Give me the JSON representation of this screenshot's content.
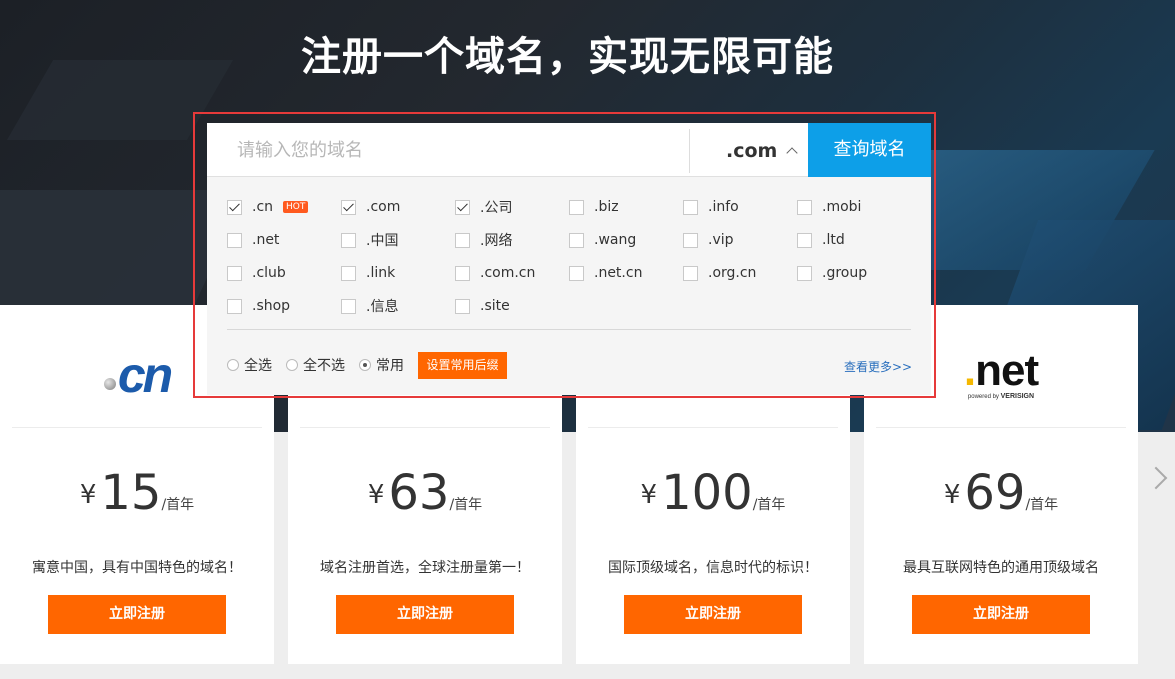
{
  "headline": "注册一个域名，实现无限可能",
  "search": {
    "placeholder": "请输入您的域名",
    "tld": ".com",
    "button": "查询域名"
  },
  "suffixes": [
    {
      "label": ".cn",
      "checked": true,
      "hot": "HOT"
    },
    {
      "label": ".com",
      "checked": true
    },
    {
      "label": ".公司",
      "checked": true
    },
    {
      "label": ".biz",
      "checked": false
    },
    {
      "label": ".info",
      "checked": false
    },
    {
      "label": ".mobi",
      "checked": false
    },
    {
      "label": ".net",
      "checked": false
    },
    {
      "label": ".中国",
      "checked": false
    },
    {
      "label": ".网络",
      "checked": false
    },
    {
      "label": ".wang",
      "checked": false
    },
    {
      "label": ".vip",
      "checked": false
    },
    {
      "label": ".ltd",
      "checked": false
    },
    {
      "label": ".club",
      "checked": false
    },
    {
      "label": ".link",
      "checked": false
    },
    {
      "label": ".com.cn",
      "checked": false
    },
    {
      "label": ".net.cn",
      "checked": false
    },
    {
      "label": ".org.cn",
      "checked": false
    },
    {
      "label": ".group",
      "checked": false
    },
    {
      "label": ".shop",
      "checked": false
    },
    {
      "label": ".信息",
      "checked": false
    },
    {
      "label": ".site",
      "checked": false
    }
  ],
  "selection": {
    "options": [
      {
        "label": "全选",
        "selected": false
      },
      {
        "label": "全不选",
        "selected": false
      },
      {
        "label": "常用",
        "selected": true
      }
    ],
    "set_button": "设置常用后缀",
    "more_link": "查看更多>>"
  },
  "cards": [
    {
      "currency": "¥",
      "price": "15",
      "unit": "/首年",
      "desc": "寓意中国，具有中国特色的域名！",
      "button": "立即注册"
    },
    {
      "currency": "¥",
      "price": "63",
      "unit": "/首年",
      "desc": "域名注册首选，全球注册量第一！",
      "button": "立即注册"
    },
    {
      "currency": "¥",
      "price": "100",
      "unit": "/首年",
      "desc": "国际顶级域名，信息时代的标识！",
      "button": "立即注册"
    },
    {
      "currency": "¥",
      "price": "69",
      "unit": "/首年",
      "desc": "最具互联网特色的通用顶级域名",
      "button": "立即注册"
    }
  ],
  "logos": {
    "cn": "cn",
    "net": "net",
    "net_dot": ".",
    "net_tagline": "powered by",
    "net_brand": "VERISIGN"
  },
  "colors": {
    "accent": "#ff6600",
    "search_button": "#0d9fe8",
    "frame": "#e63a3a",
    "cn_logo": "#1c5bab"
  }
}
